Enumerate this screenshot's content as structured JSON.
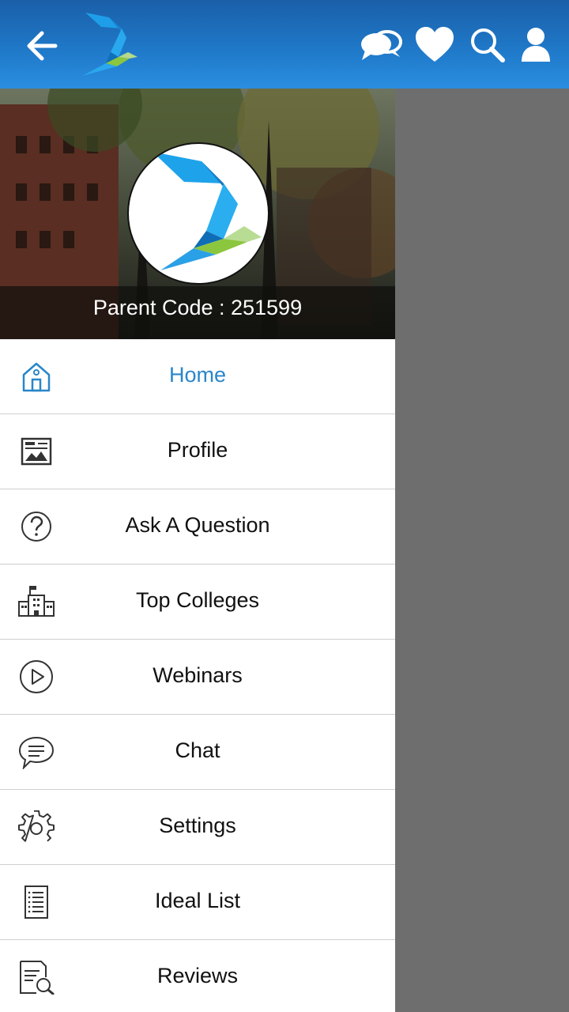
{
  "topbar": {
    "back_icon": "arrow-left-icon",
    "logo": "bird-logo",
    "actions": [
      "chat-bubbles-icon",
      "heart-icon",
      "search-icon",
      "user-icon"
    ]
  },
  "drawer": {
    "parent_code": "Parent Code : 251599",
    "menu": [
      {
        "label": "Home",
        "icon": "home-icon",
        "active": true
      },
      {
        "label": "Profile",
        "icon": "profile-card-icon"
      },
      {
        "label": "Ask A Question",
        "icon": "question-icon"
      },
      {
        "label": "Top Colleges",
        "icon": "college-building-icon"
      },
      {
        "label": "Webinars",
        "icon": "play-icon"
      },
      {
        "label": "Chat",
        "icon": "chat-icon"
      },
      {
        "label": "Settings",
        "icon": "gear-icon"
      },
      {
        "label": "Ideal List",
        "icon": "list-icon"
      },
      {
        "label": "Reviews",
        "icon": "reviews-icon"
      }
    ]
  },
  "colors": {
    "topbar": "#1f78c8",
    "active": "#2a86c9",
    "scrim": "#6e6e6e"
  }
}
